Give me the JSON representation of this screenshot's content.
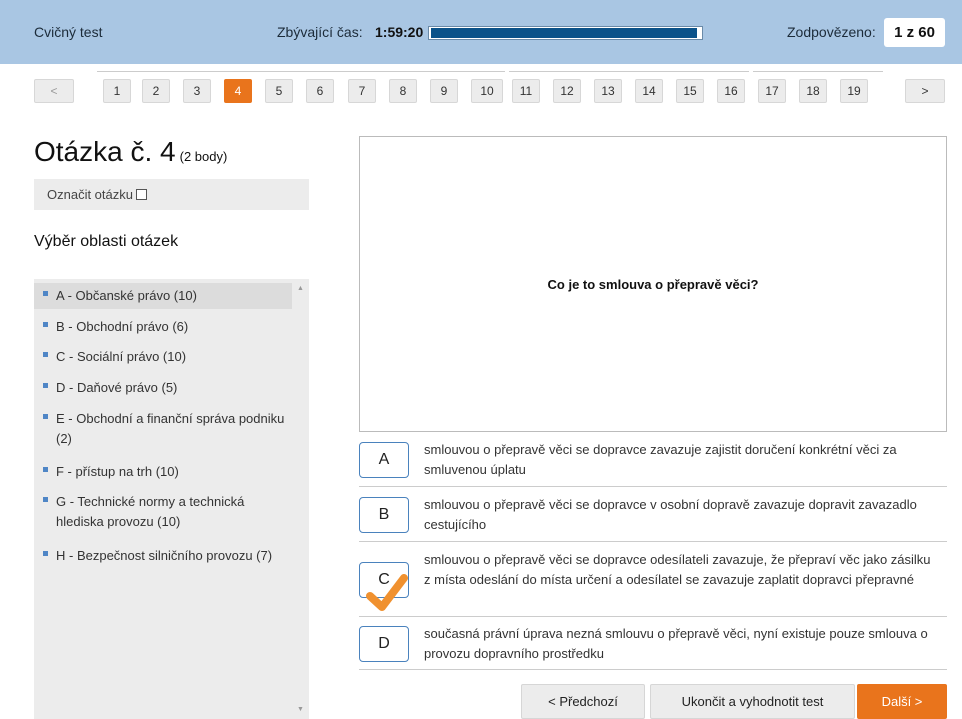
{
  "header": {
    "app_title": "Cvičný test",
    "time_label": "Zbývající čas:",
    "time_value": "1:59:20",
    "time_remaining_fraction": 0.99,
    "answered_label": "Zodpovězeno:",
    "answered_value": "1 z 60"
  },
  "pager": {
    "prev": "<",
    "next": ">",
    "pages": [
      "1",
      "2",
      "3",
      "4",
      "5",
      "6",
      "7",
      "8",
      "9",
      "10",
      "11",
      "12",
      "13",
      "14",
      "15",
      "16",
      "17",
      "18",
      "19"
    ],
    "current": "4"
  },
  "question": {
    "title": "Otázka č. 4",
    "points": "(2 body)",
    "mark_label": "Označit otázku",
    "text": "Co je to smlouva o přepravě věci?"
  },
  "areas": {
    "title": "Výběr oblasti otázek",
    "items": [
      "A - Občanské právo (10)",
      "B - Obchodní právo (6)",
      "C - Sociální právo (10)",
      "D - Daňové právo (5)",
      "E - Obchodní a finanční správa podniku (2)",
      "F - přístup na trh (10)",
      "G - Technické normy a technická hlediska provozu (10)",
      "H - Bezpečnost silničního provozu (7)"
    ]
  },
  "answers": [
    {
      "letter": "A",
      "text": "smlouvou o přepravě věci se dopravce zavazuje zajistit doručení konkrétní věci za smluvenou úplatu"
    },
    {
      "letter": "B",
      "text": "smlouvou o přepravě věci se dopravce v osobní dopravě zavazuje dopravit zavazadlo cestujícího"
    },
    {
      "letter": "C",
      "text": "smlouvou o přepravě věci se dopravce odesílateli zavazuje, že přepraví věc jako zásilku z místa odeslání do místa určení a odesílatel se zavazuje zaplatit dopravci přepravné"
    },
    {
      "letter": "D",
      "text": "současná právní úprava nezná smlouvu o přepravě věci, nyní existuje pouze smlouva o provozu dopravního prostředku"
    }
  ],
  "selected_answer": "C",
  "buttons": {
    "prev": "< Předchozí",
    "finish": "Ukončit a vyhodnotit test",
    "next": "Další >"
  },
  "colors": {
    "header_bg": "#a9c6e3",
    "accent": "#e9741c",
    "progress": "#0b5289"
  }
}
